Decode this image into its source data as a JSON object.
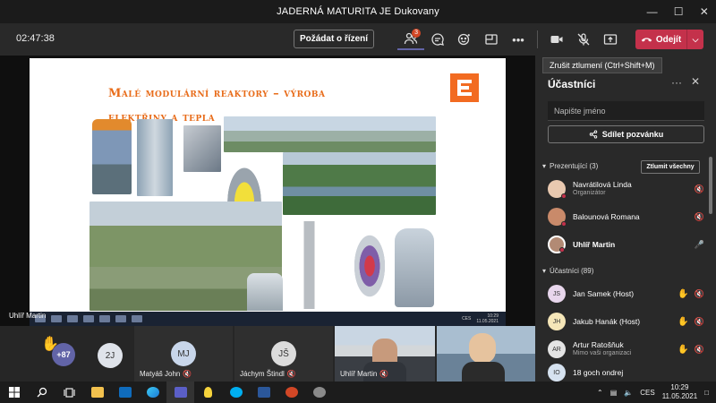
{
  "window": {
    "title": "JADERNÁ MATURITA JE Dukovany",
    "controls": {
      "minimize": "—",
      "maximize": "☐",
      "close": "✕"
    }
  },
  "callbar": {
    "timer": "02:47:38",
    "request_control": "Požádat o řízení",
    "participants_badge": "3",
    "more": "•••",
    "leave_label": "Odejít",
    "accent": "#c4314b"
  },
  "tooltip": "Zrušit ztlumení (Ctrl+Shift+M)",
  "slide": {
    "title_line1": "Malé modulární reaktory – výroba",
    "title_line2": "elektřiny a tepla",
    "title_color": "#e86c1a",
    "taskbar_time": "10:29",
    "taskbar_date": "11.05.2021",
    "taskbar_lang": "CES"
  },
  "stage": {
    "presenter_name": "Uhlíř Martin"
  },
  "gallery": {
    "raised_hands": "+87",
    "tiles": [
      {
        "initials": "2J",
        "name": ""
      },
      {
        "initials": "MJ",
        "name": "Matyáš John"
      },
      {
        "initials": "JŠ",
        "name": "Jáchym Štindl"
      },
      {
        "initials": "",
        "name": "Uhlíř Martin"
      },
      {
        "initials": "",
        "name": ""
      }
    ]
  },
  "panel": {
    "title": "Účastníci",
    "more": "···",
    "close": "✕",
    "search_placeholder": "Napište jméno",
    "share_label": "Sdílet pozvánku",
    "presenters_label": "Prezentující (3)",
    "mute_all": "Ztlumit všechny",
    "presenters": [
      {
        "name": "Navrátilová Linda",
        "role": "Organizátor"
      },
      {
        "name": "Balounová Romana",
        "role": ""
      },
      {
        "name": "Uhlíř Martin",
        "role": ""
      }
    ],
    "attendees_label": "Účastníci (89)",
    "attendees": [
      {
        "initials": "JS",
        "name": "Jan Samek (Host)",
        "role": ""
      },
      {
        "initials": "JH",
        "name": "Jakub Hanák (Host)",
        "role": ""
      },
      {
        "initials": "AR",
        "name": "Artur Ratošňuk",
        "role": "Mimo vaši organizaci"
      },
      {
        "initials": "IO",
        "name": "18 goch ondrej",
        "role": ""
      }
    ]
  },
  "taskbar": {
    "lang": "CES",
    "time": "10:29",
    "date": "11.05.2021"
  }
}
